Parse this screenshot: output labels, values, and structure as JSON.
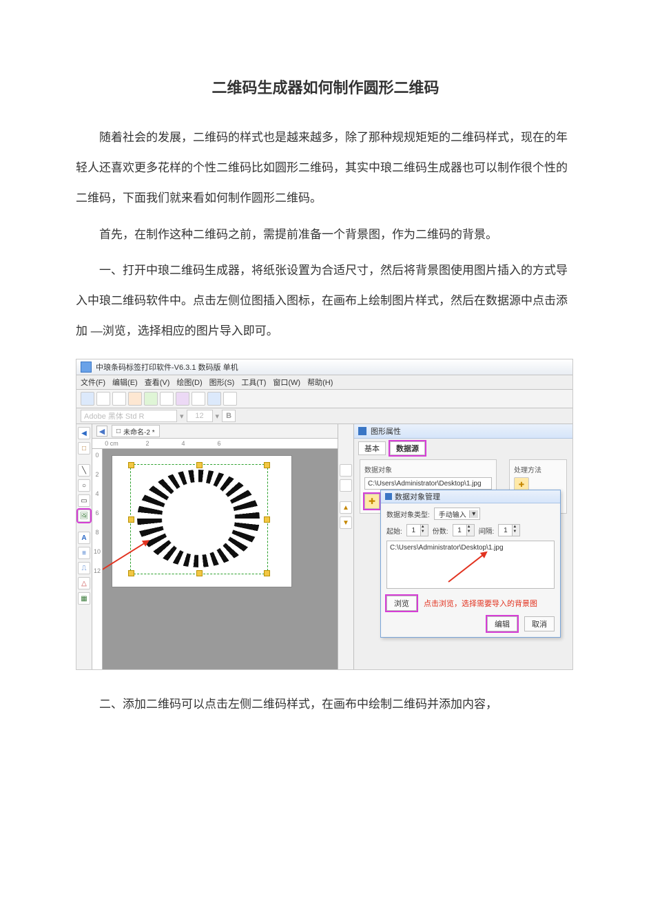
{
  "doc": {
    "title": "二维码生成器如何制作圆形二维码",
    "p1": "随着社会的发展，二维码的样式也是越来越多，除了那种规规矩矩的二维码样式，现在的年轻人还喜欢更多花样的个性二维码比如圆形二维码，其实中琅二维码生成器也可以制作很个性的二维码，下面我们就来看如何制作圆形二维码。",
    "p2": "首先，在制作这种二维码之前，需提前准备一个背景图，作为二维码的背景。",
    "p3": "一、打开中琅二维码生成器，将纸张设置为合适尺寸，然后将背景图使用图片插入的方式导入中琅二维码软件中。点击左侧位图插入图标，在画布上绘制图片样式，然后在数据源中点击添加 —浏览，选择相应的图片导入即可。",
    "p4": "二、添加二维码可以点击左侧二维码样式，在画布中绘制二维码并添加内容，"
  },
  "app": {
    "title": "中琅条码标签打印软件-V6.3.1 数码版 单机",
    "menus": [
      "文件(F)",
      "编辑(E)",
      "查看(V)",
      "绘图(D)",
      "图形(S)",
      "工具(T)",
      "窗口(W)",
      "帮助(H)"
    ],
    "font_name": "Adobe 黑体 Std R",
    "font_size": "12",
    "font_bold": "B",
    "doc_tab": "未命名-2 *",
    "ruler_h": [
      "0 cm",
      "2",
      "4",
      "6"
    ],
    "ruler_v": [
      "0",
      "2",
      "4",
      "6",
      "8",
      "10",
      "12"
    ]
  },
  "panel": {
    "title": "图形属性",
    "tabs": {
      "basic": "基本",
      "datasource": "数据源"
    },
    "data_obj_label": "数据对象",
    "process_label": "处理方法",
    "path": "C:\\Users\\Administrator\\Desktop\\1.jpg"
  },
  "dialog": {
    "title": "数据对象管理",
    "type_label": "数据对象类型:",
    "type_value": "手动输入",
    "start_label": "起始:",
    "start_value": "1",
    "count_label": "份数:",
    "count_value": "1",
    "step_label": "间隔:",
    "step_value": "1",
    "textarea_value": "C:\\Users\\Administrator\\Desktop\\1.jpg",
    "browse": "浏览",
    "hint": "点击浏览，选择需要导入的背景图",
    "edit": "编辑",
    "cancel": "取消"
  },
  "icons": {
    "pointer_left": "◀",
    "pointer_right": "▶",
    "square": "□",
    "text_a": "A",
    "line": "╲",
    "circle": "○",
    "rect": "▭",
    "image": "🖼",
    "table": "▦",
    "tri": "△",
    "list": "≡",
    "plus": "✚",
    "up": "▲",
    "down": "▼",
    "chev": "▾"
  }
}
